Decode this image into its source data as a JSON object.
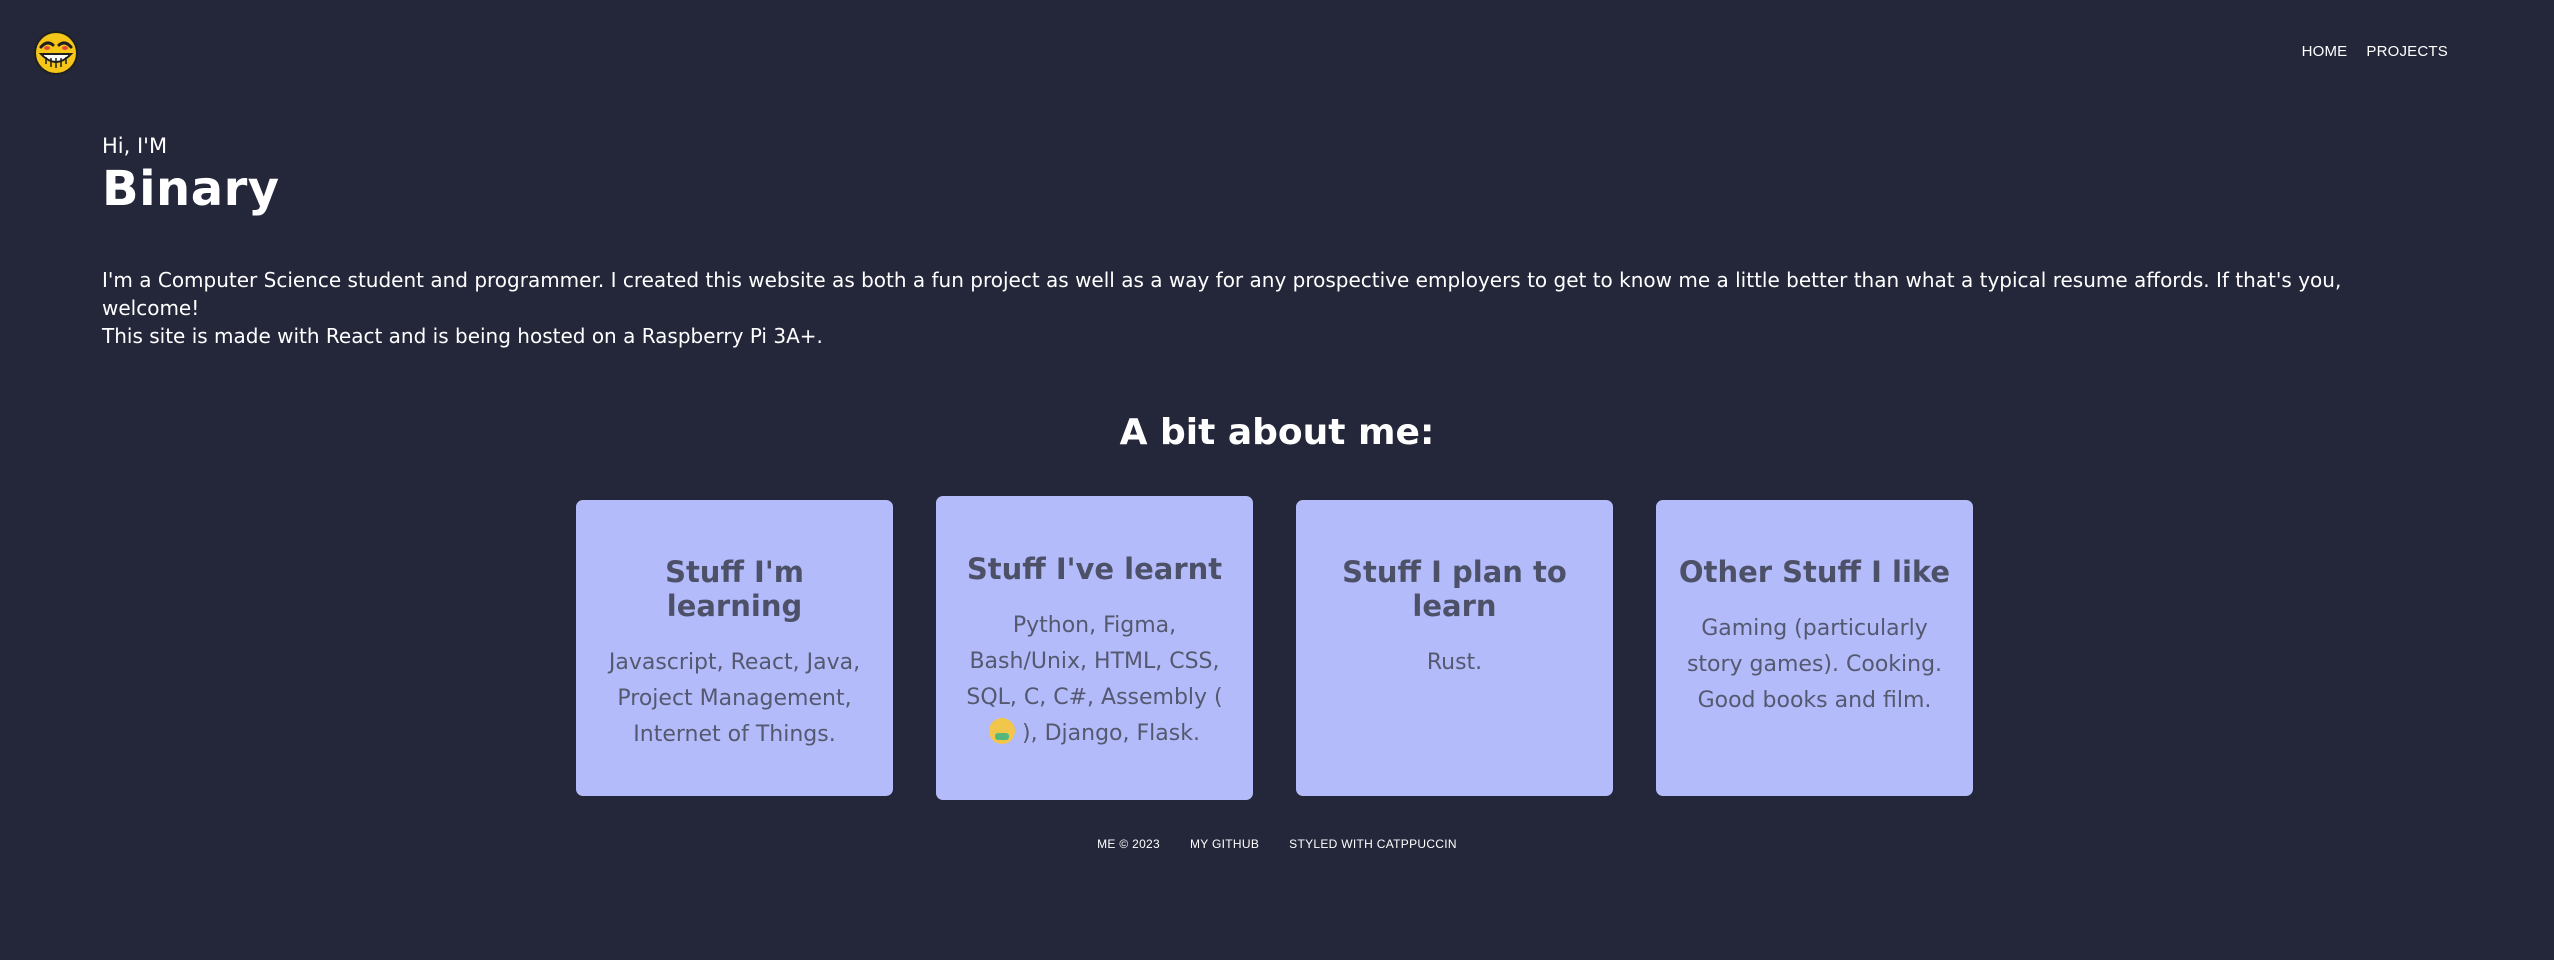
{
  "header": {
    "logo_icon": "grinning-face-icon",
    "nav": {
      "home": "HOME",
      "projects": "PROJECTS"
    }
  },
  "hero": {
    "greeting": "Hi, I'M",
    "name": "Binary",
    "intro_line_1": "I'm a Computer Science student and programmer. I created this website as both a fun project as well as a way for any prospective employers to get to know me a little better than what a typical resume affords. If that's you, welcome!",
    "intro_line_2": "This site is made with React and is being hosted on a Raspberry Pi 3A+."
  },
  "about": {
    "title": "A bit about me:",
    "cards": [
      {
        "title": "Stuff I'm learning",
        "body": "Javascript, React, Java, Project Management, Internet of Things."
      },
      {
        "title": "Stuff I've learnt",
        "body_before": "Python, Figma, Bash/Unix, HTML, CSS, SQL, C, C#, Assembly (",
        "body_after": "), Django, Flask.",
        "emoji_icon": "nauseated-face-icon"
      },
      {
        "title": "Stuff I plan to learn",
        "body": "Rust."
      },
      {
        "title": "Other Stuff I like",
        "body": "Gaming (particularly story games). Cooking. Good books and film."
      }
    ]
  },
  "footer": {
    "copyright": "ME © 2023",
    "github": "MY GITHUB",
    "styled": "STYLED WITH CATPPUCCIN"
  },
  "colors": {
    "background": "#24273a",
    "card": "#b3bbfa",
    "card_text": "#4d5168"
  }
}
